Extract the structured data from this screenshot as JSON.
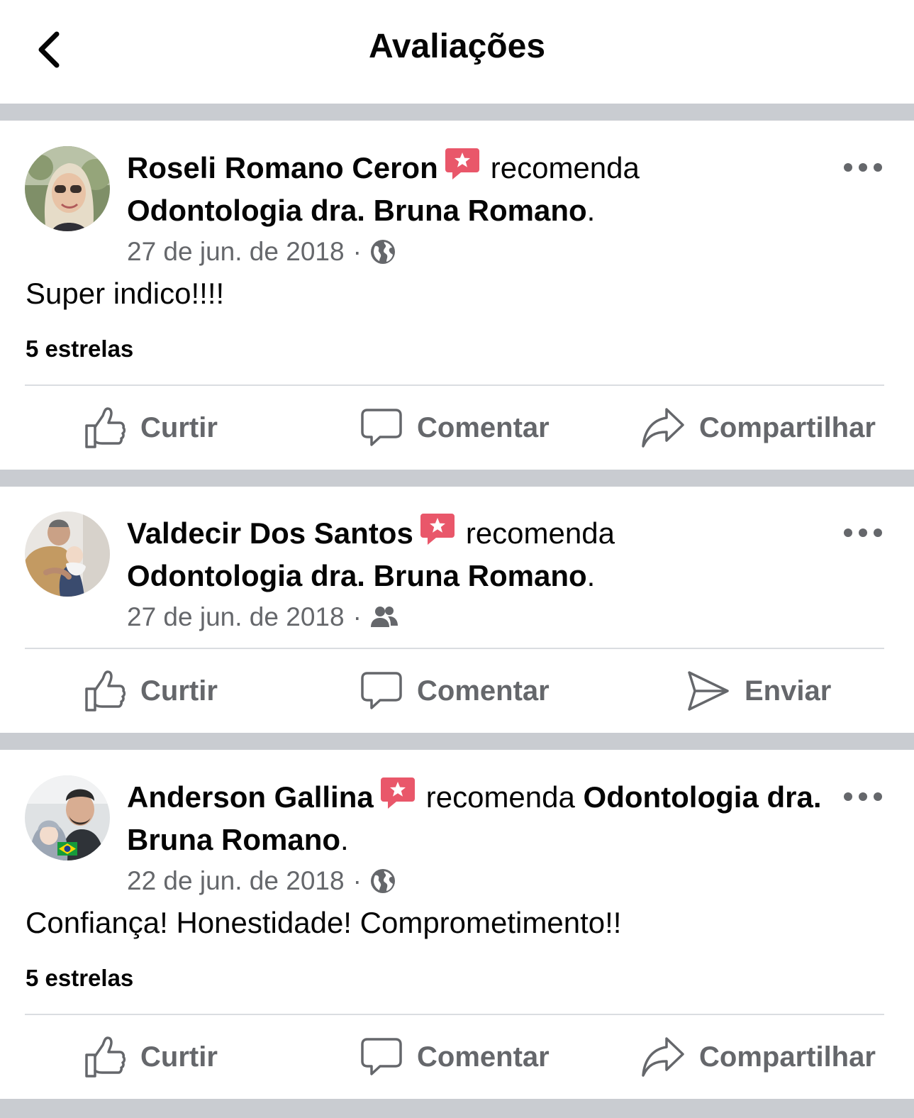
{
  "header": {
    "title": "Avaliações",
    "back_icon": "chevron-left-icon"
  },
  "colors": {
    "badge": "#e9576a",
    "muted": "#65676b",
    "separator": "#c9ccd1",
    "divider": "#dadde1"
  },
  "reviews": [
    {
      "author": "Roseli Romano Ceron",
      "verb": "recomenda",
      "page": "Odontologia dra. Bruna Romano",
      "date": "27 de jun. de 2018",
      "audience_icon": "globe-icon",
      "text": "Super indico!!!!",
      "rating": "5 estrelas",
      "actions": [
        "Curtir",
        "Comentar",
        "Compartilhar"
      ]
    },
    {
      "author": "Valdecir Dos Santos",
      "verb": "recomenda",
      "page": "Odontologia dra. Bruna Romano",
      "date": "27 de jun. de 2018",
      "audience_icon": "friends-icon",
      "actions": [
        "Curtir",
        "Comentar",
        "Enviar"
      ]
    },
    {
      "author": "Anderson Gallina",
      "verb": "recomenda",
      "page": "Odontologia dra. Bruna Romano",
      "date": "22 de jun. de 2018",
      "audience_icon": "globe-icon",
      "text": "Confiança! Honestidade! Comprometimento!!",
      "rating": "5 estrelas",
      "actions": [
        "Curtir",
        "Comentar",
        "Compartilhar"
      ]
    }
  ]
}
